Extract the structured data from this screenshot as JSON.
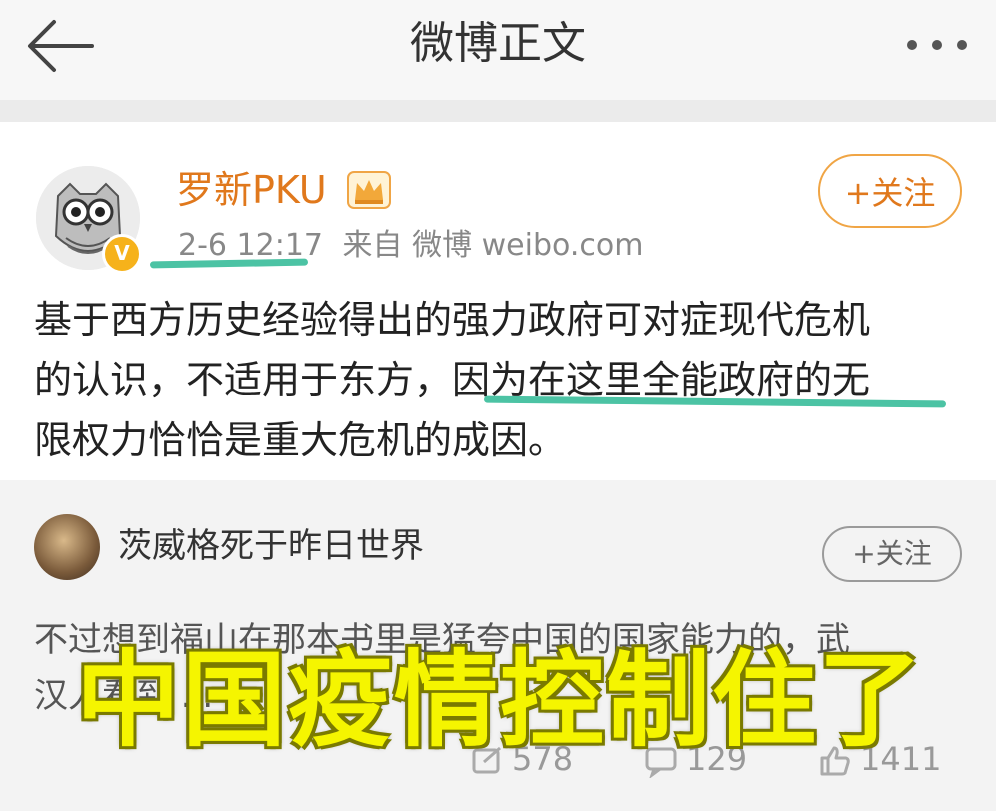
{
  "nav": {
    "title": "微博正文",
    "back_icon": "arrow-left-icon",
    "more_icon": "more-dots-icon"
  },
  "post": {
    "author": "罗新PKU",
    "verified_badge": "V",
    "crown_icon": "crown-icon",
    "time": "2-6 12:17",
    "source": "来自 微博 weibo.com",
    "follow_label": "+关注",
    "lines": [
      "基于西方历史经验得出的强力政府可对症现代危机",
      "的认识，不适用于东方，因为在这里全能政府的无",
      "限权力恰恰是重大危机的成因。"
    ],
    "highlight_color": "#4cc3a4"
  },
  "repost": {
    "author": "茨威格死于昨日世界",
    "follow_label": "+关注",
    "lines": [
      "不过想到福山在那本书里是猛夸中国的国家能力的，武",
      "汉人看到 ... "
    ],
    "stats": {
      "reposts": "578",
      "comments": "129",
      "likes": "1411"
    }
  },
  "overlay_caption": "中国疫情控制住了",
  "colors": {
    "author_orange": "#e0781c",
    "overlay_yellow": "#f5f500"
  }
}
